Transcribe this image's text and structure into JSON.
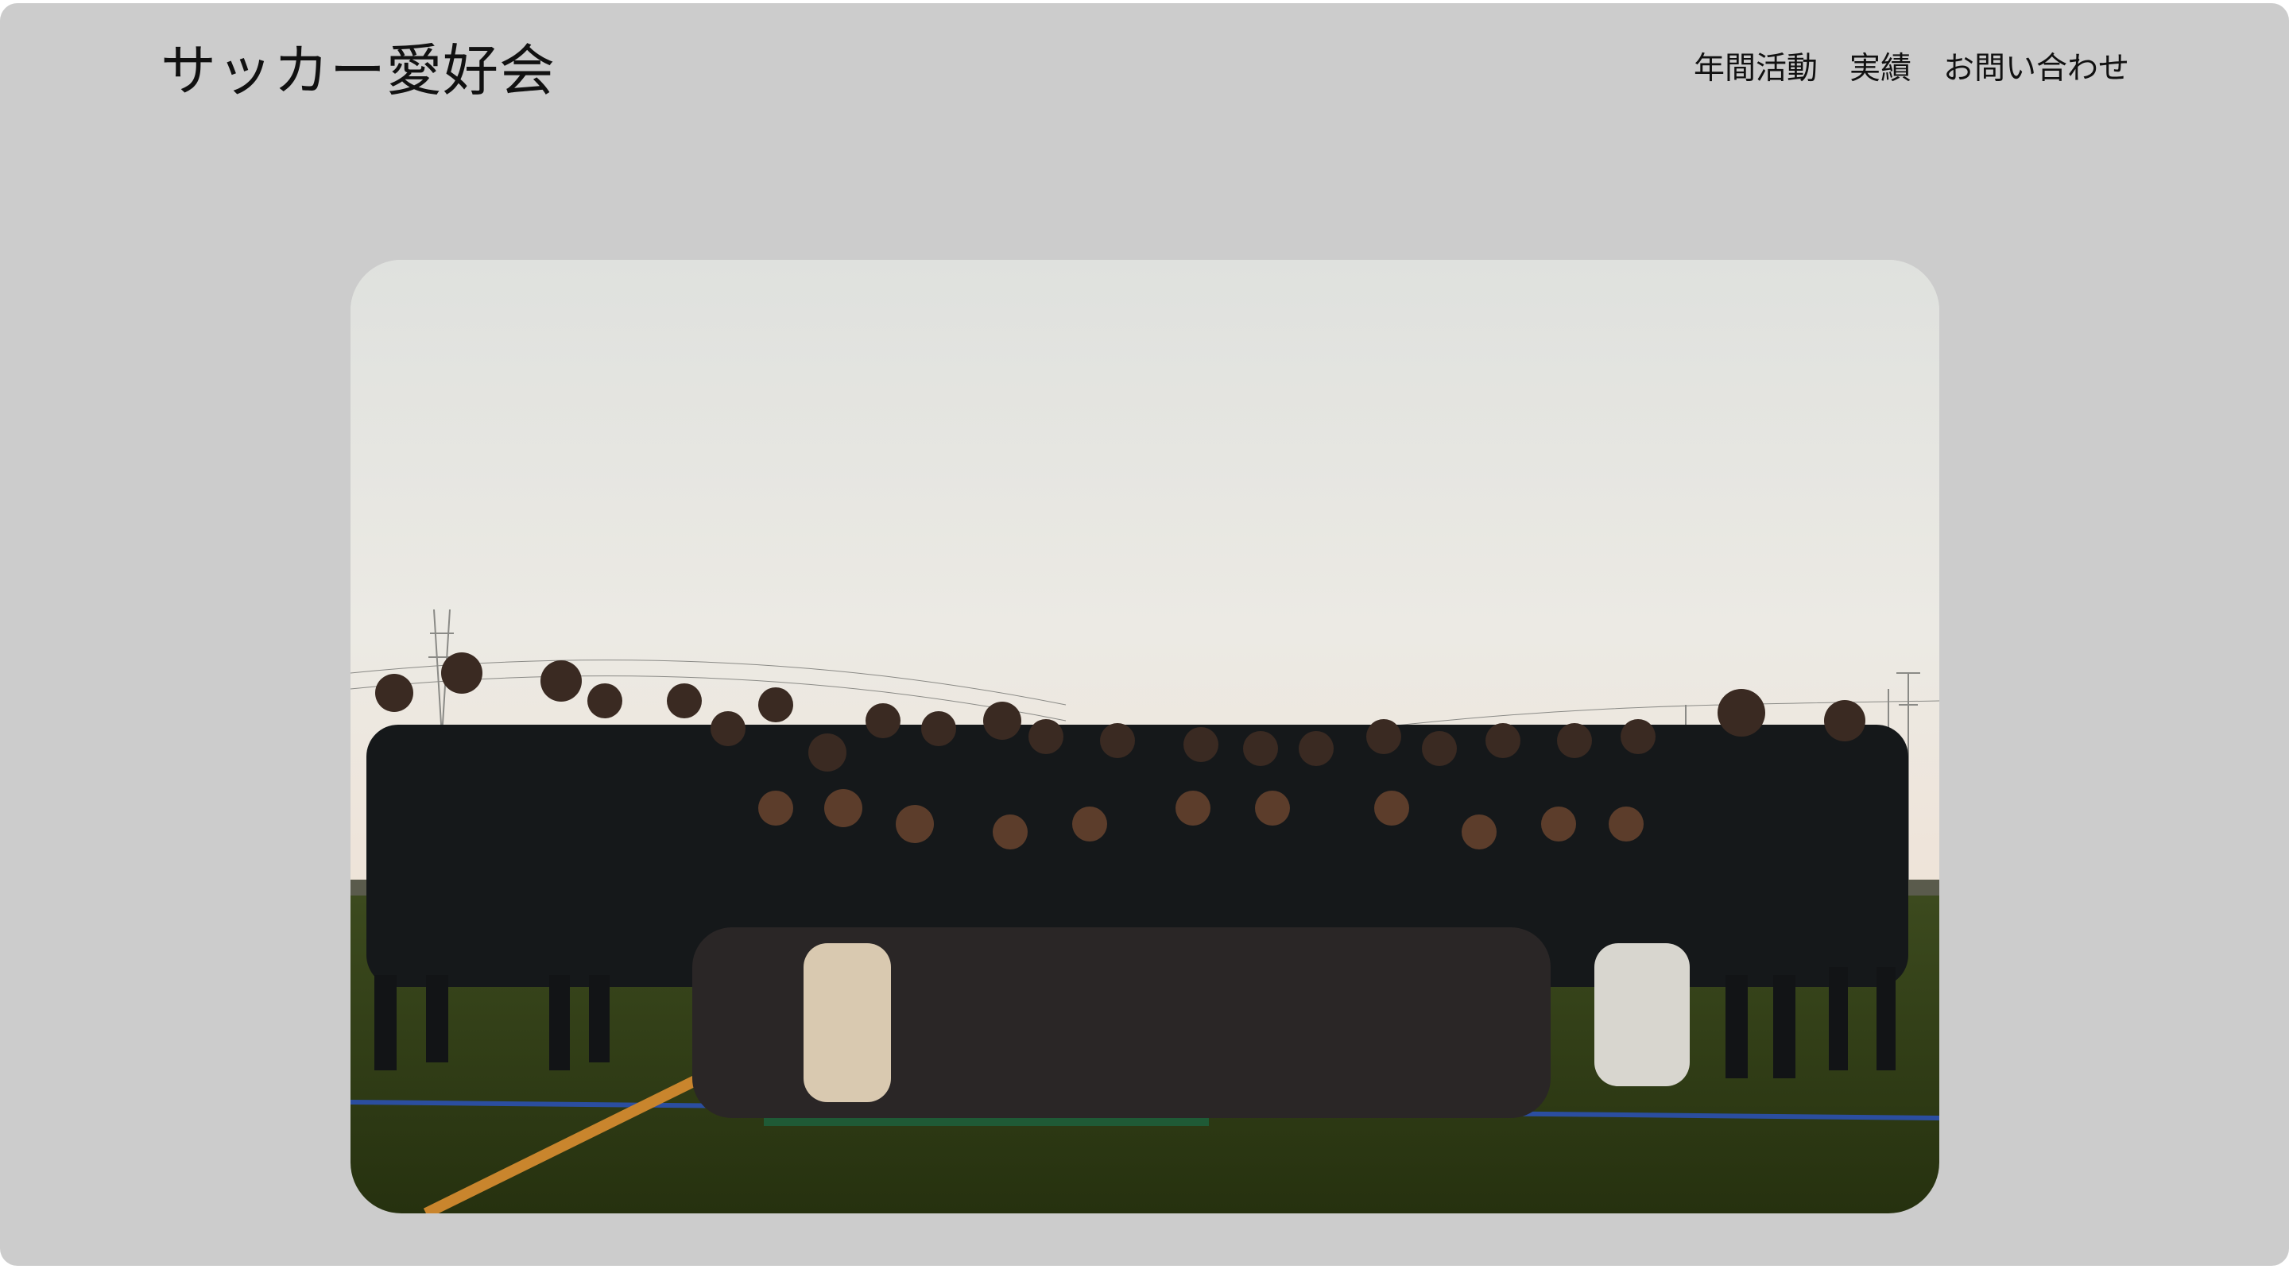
{
  "header": {
    "site_title": "サッカー愛好会",
    "nav": [
      {
        "label": "年間活動"
      },
      {
        "label": "実績"
      },
      {
        "label": "お問い合わせ"
      }
    ]
  },
  "hero": {
    "image": "team-group-photo"
  },
  "colors": {
    "page_background": "#cccccc",
    "text": "#111111"
  }
}
